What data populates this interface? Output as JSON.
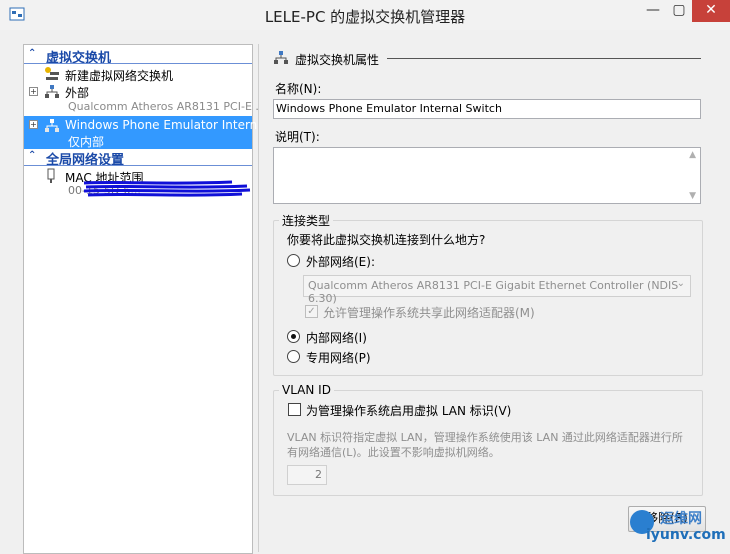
{
  "window": {
    "title": "LELE-PC 的虚拟交换机管理器",
    "min": "—",
    "max": "▢",
    "close": "✕",
    "close_color": "#c7413a"
  },
  "sidebar": {
    "section_virtual_switches": "虚拟交换机",
    "new_switch": "新建虚拟网络交换机",
    "external_switch": {
      "label": "外部",
      "adapter": "Qualcomm Atheros AR8131 PCI-E ..."
    },
    "selected_switch": {
      "label": "Windows Phone Emulator Internal ...",
      "type": "仅内部"
    },
    "section_global": "全局网络设置",
    "mac_range": {
      "label": "MAC 地址范围",
      "value_obscured": "00-15-5D-6..."
    },
    "selection_color": "#3399ff",
    "section_color": "#1b4aa8"
  },
  "properties": {
    "header": "虚拟交换机属性",
    "name_label": "名称(N):",
    "name_value": "Windows Phone Emulator Internal Switch",
    "notes_label": "说明(T):",
    "notes_value": "",
    "connection_type": {
      "title": "连接类型",
      "question": "你要将此虚拟交换机连接到什么地方?",
      "external_label": "外部网络(E):",
      "adapter_selected": "Qualcomm Atheros AR8131 PCI-E Gigabit Ethernet Controller (NDIS 6.30)",
      "allow_share_label": "允许管理操作系统共享此网络适配器(M)",
      "internal_label": "内部网络(I)",
      "private_label": "专用网络(P)",
      "selected": "internal"
    },
    "vlan": {
      "title": "VLAN ID",
      "enable_label": "为管理操作系统启用虚拟 LAN 标识(V)",
      "description": "VLAN 标识符指定虚拟 LAN，管理操作系统使用该 LAN 通过此网络适配器进行所有网络通信(L)。此设置不影响虚拟机网络。",
      "id_value": "2"
    },
    "remove_button": "移除(R)"
  },
  "watermark": {
    "line1": "运维网",
    "line2": "iyunv.com"
  }
}
